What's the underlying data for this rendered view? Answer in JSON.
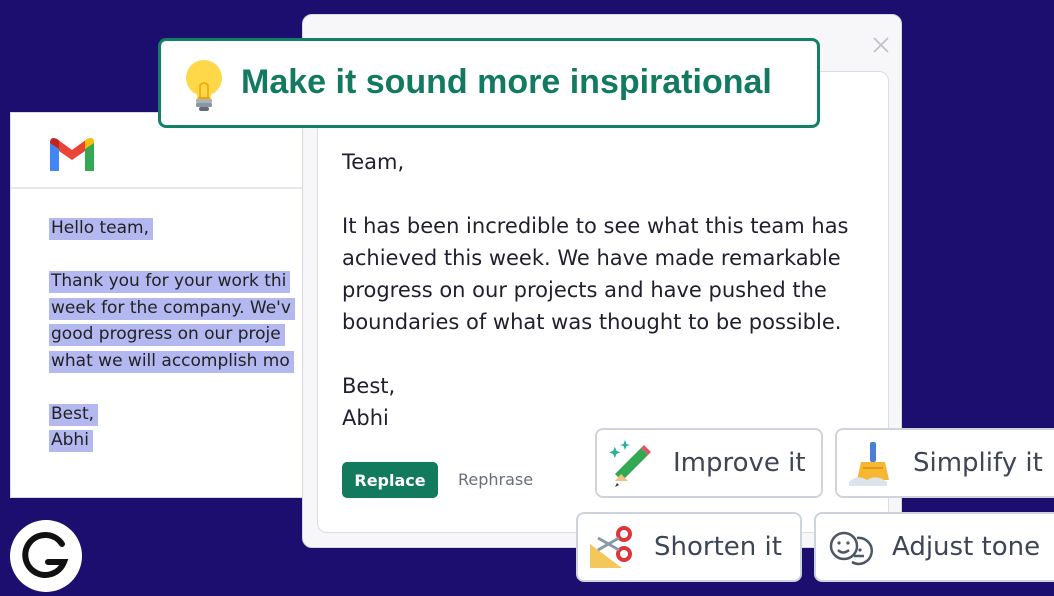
{
  "gmail": {
    "logo": "gmail-logo",
    "lines": [
      "Hello team,",
      "",
      "Thank you for your work thi",
      "week for the company. We'v",
      "good progress on our proje",
      "what we will accomplish mo",
      "",
      "Best,",
      "Abhi"
    ]
  },
  "banner": {
    "icon": "lightbulb-icon",
    "prompt": "Make it sound more inspirational"
  },
  "popup": {
    "close_icon": "close-icon",
    "greeting": "Team,",
    "paragraph": "It has been incredible to see what this team has achieved this week. We have made remarkable progress on our projects and have pushed the boundaries of what was thought to be possible.",
    "signoff": "Best,",
    "name": "Abhi",
    "replace_label": "Replace",
    "rephrase_label": "Rephrase"
  },
  "actions": {
    "improve": "Improve it",
    "simplify": "Simplify it",
    "shorten": "Shorten it",
    "adjust": "Adjust tone"
  },
  "colors": {
    "background": "#1b0e6e",
    "accent_green": "#137a62",
    "highlight": "#b3b8f0"
  }
}
